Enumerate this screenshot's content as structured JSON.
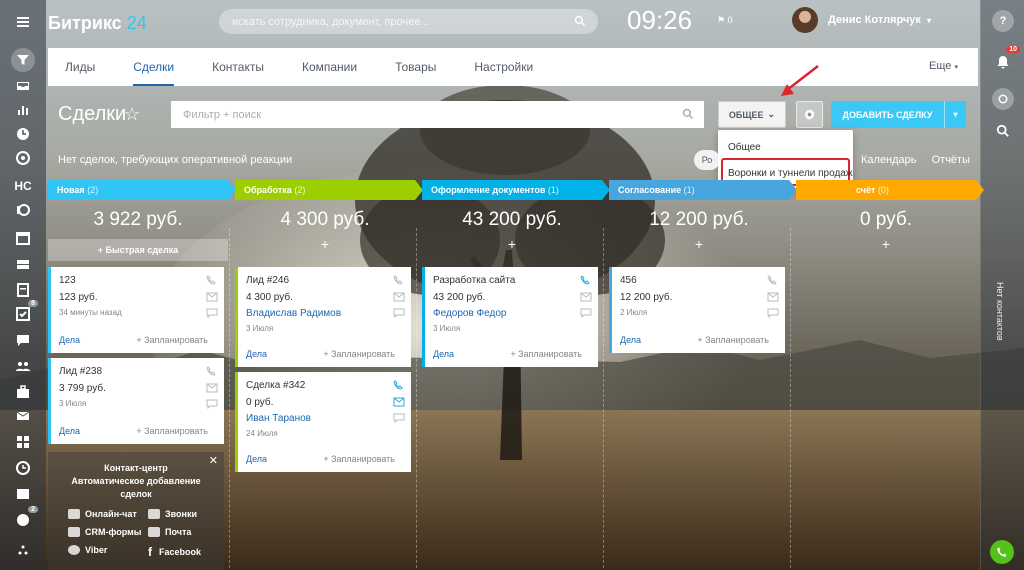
{
  "header": {
    "logo": "Битрикс",
    "logo_num": "24",
    "search_placeholder": "искать сотрудника, документ, прочее...",
    "clock": "09:26",
    "flag_count": "0",
    "user_name": "Денис Котлярчук"
  },
  "tabs": [
    "Лиды",
    "Сделки",
    "Контакты",
    "Компании",
    "Товары",
    "Настройки"
  ],
  "tabs_more": "Еще",
  "page": {
    "title": "Сделки",
    "filter_placeholder": "Фильтр + поиск",
    "obshee_label": "ОБЩЕЕ",
    "add_label": "ДОБАВИТЬ СДЕЛКУ",
    "no_reactions": "Нет сделок, требующих оперативной реакции",
    "ro_pill": "Ро",
    "calendar": "Календарь",
    "reports": "Отчёты"
  },
  "dropdown": {
    "item1": "Общее",
    "item2": "Воронки и туннели продаж"
  },
  "columns": [
    {
      "name": "Новая",
      "count": "(2)",
      "sum": "3 922 руб.",
      "color": "#2fc6f6"
    },
    {
      "name": "Обработка",
      "count": "(2)",
      "sum": "4 300 руб.",
      "color": "#9dcf00"
    },
    {
      "name": "Оформление документов",
      "count": "(1)",
      "sum": "43 200 руб.",
      "color": "#00b2e7"
    },
    {
      "name": "Согласование",
      "count": "(1)",
      "sum": "12 200 руб.",
      "color": "#47a6dd"
    },
    {
      "name": "счёт",
      "count": "(0)",
      "sum": "0 руб.",
      "color": "#ffa900"
    }
  ],
  "quick_deal": "+ Быстрая сделка",
  "cards": {
    "c1": {
      "title": "123",
      "price": "123 руб.",
      "date": "34 минуты назад"
    },
    "c2": {
      "title": "Лид #238",
      "price": "3 799 руб.",
      "date": "3 Июля"
    },
    "c3": {
      "title": "Лид #246",
      "price": "4 300 руб.",
      "contact": "Владислав Радимов",
      "date": "3 Июля"
    },
    "c4": {
      "title": "Сделка #342",
      "price": "0 руб.",
      "contact": "Иван Таранов",
      "date": "24 Июля"
    },
    "c5": {
      "title": "Разработка сайта",
      "price": "43 200 руб.",
      "contact": "Федоров Федор",
      "date": "3 Июля"
    },
    "c6": {
      "title": "456",
      "price": "12 200 руб.",
      "date": "2 Июля"
    }
  },
  "card_actions": {
    "deals": "Дела",
    "plan": "+ Запланировать"
  },
  "contact_center": {
    "title_line1": "Контакт-центр",
    "title_line2": "Автоматическое добавление",
    "title_line3": "сделок",
    "items": [
      "Онлайн-чат",
      "Звонки",
      "CRM-формы",
      "Почта",
      "Viber",
      "Facebook"
    ]
  },
  "right_bar": {
    "notif_badge": "10",
    "no_contacts": "Нет контактов"
  },
  "left_bar": {
    "hc_label": "HC",
    "badge_8": "8",
    "badge_2": "2"
  }
}
